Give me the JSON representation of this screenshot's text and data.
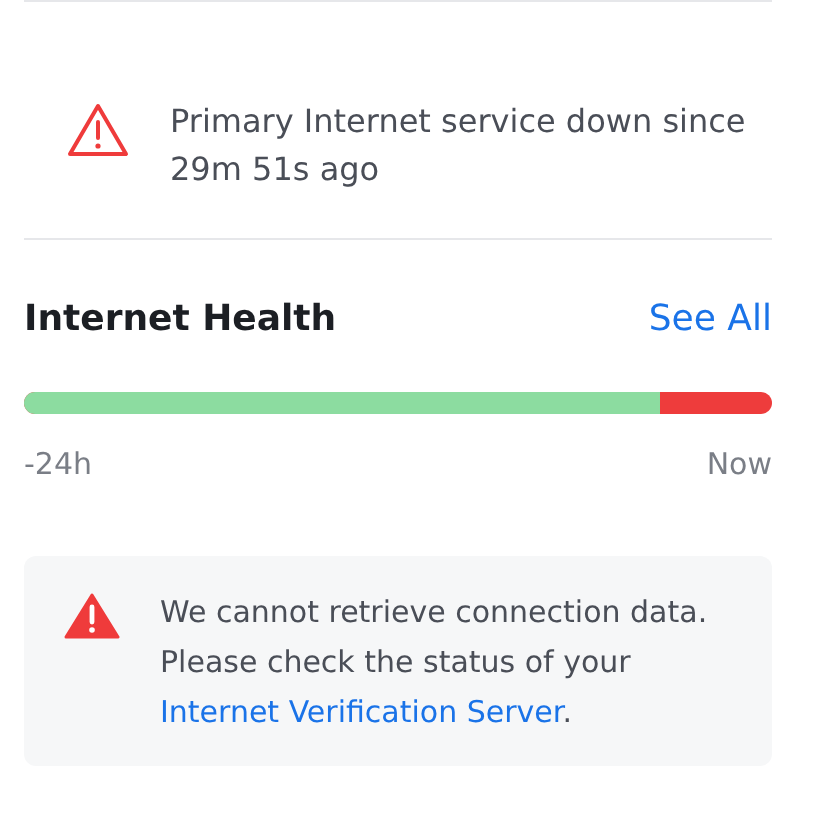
{
  "outage_alert": {
    "message": "Primary Internet service down since 29m 51s ago"
  },
  "internet_health": {
    "title": "Internet Health",
    "see_all": "See All",
    "uptime": {
      "level": 0.85
    },
    "start_label": "-24h",
    "end_label": "Now"
  },
  "notice": {
    "text": "We cannot retrieve connection data. Please check the status of your",
    "link": "Internet Verification Server",
    "suffix": "."
  }
}
